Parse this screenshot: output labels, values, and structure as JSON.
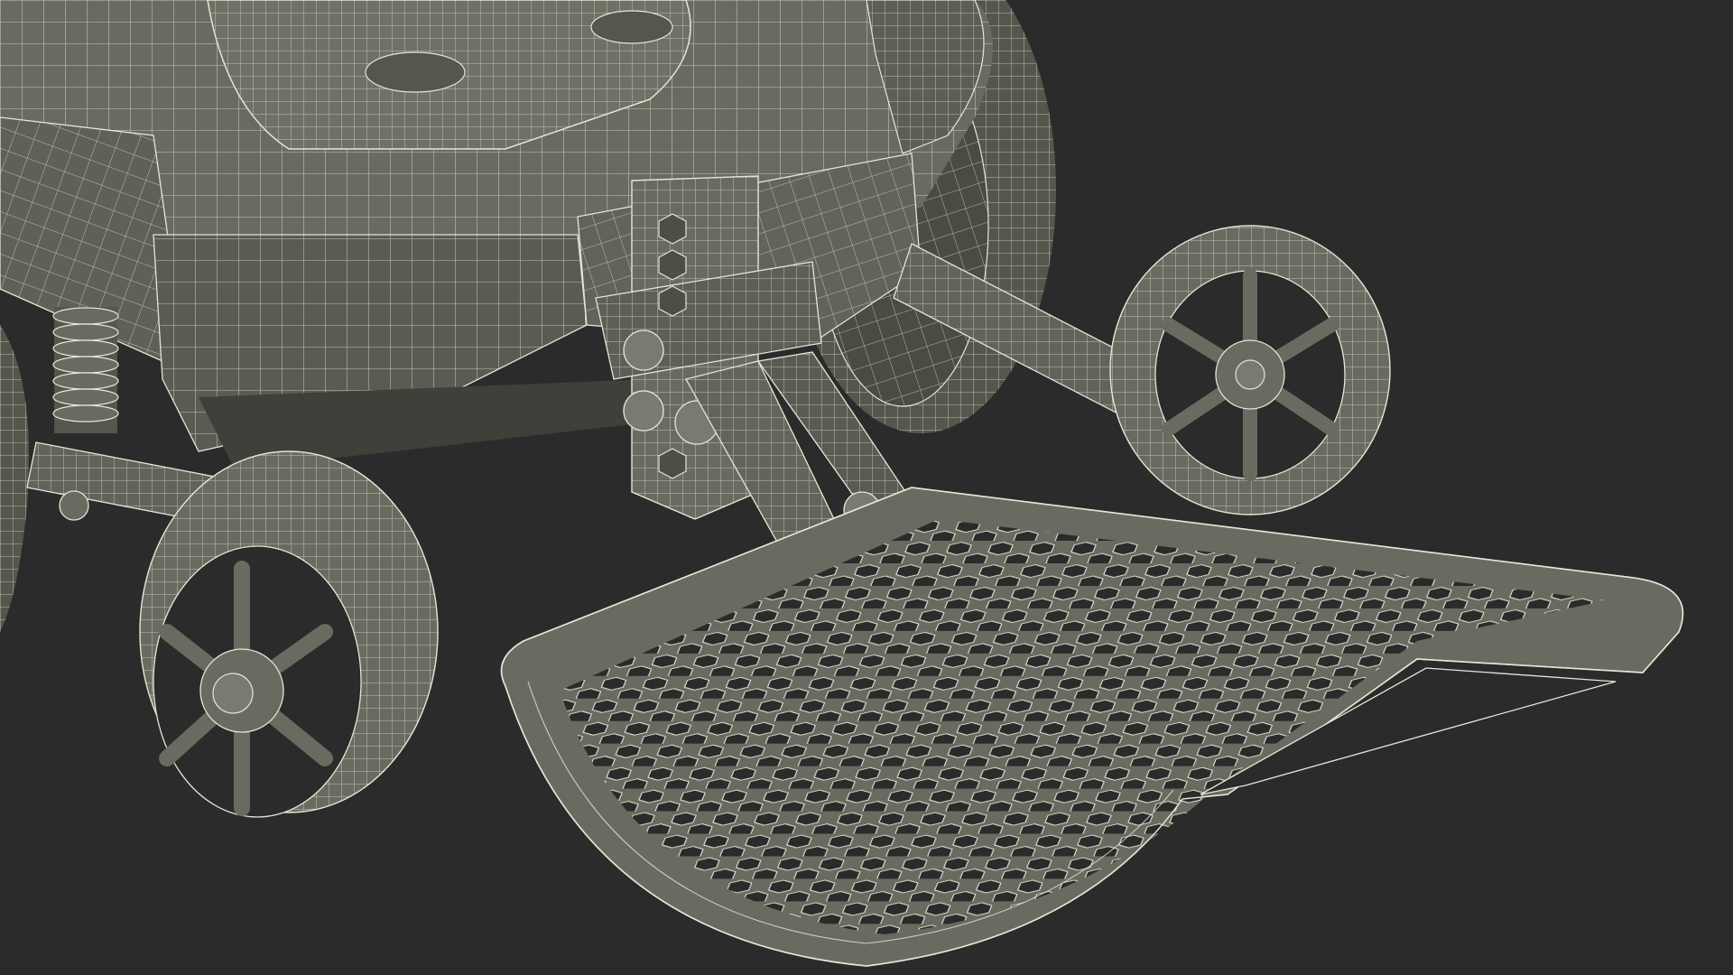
{
  "scene": {
    "background_color": "#2b2b2b",
    "mesh_fill_color": "#6a6b60",
    "mesh_shade_color": "#55564c",
    "mesh_dark_color": "#3f403a",
    "wire_color": "#e6e6d6",
    "hole_color": "#2b2b2b"
  }
}
